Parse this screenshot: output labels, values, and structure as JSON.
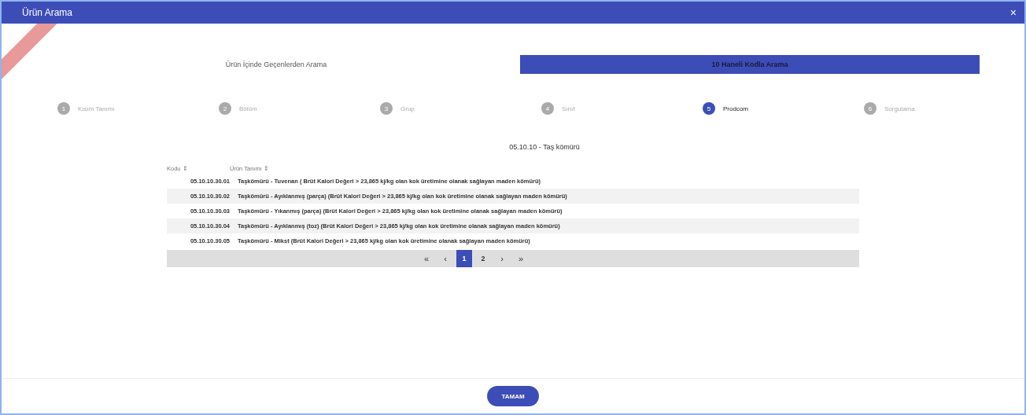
{
  "window": {
    "title": "Ürün Arama",
    "close": "×"
  },
  "tabs": [
    {
      "label": "Ürün İçinde Geçenlerden Arama",
      "selected": false
    },
    {
      "label": "10 Haneli Kodla Arama",
      "selected": true
    }
  ],
  "steps": [
    {
      "number": "1",
      "label": "Kısım Tanımı",
      "selected": false
    },
    {
      "number": "2",
      "label": "Bölüm",
      "selected": false
    },
    {
      "number": "3",
      "label": "Grup",
      "selected": false
    },
    {
      "number": "4",
      "label": "Sınıf",
      "selected": false
    },
    {
      "number": "5",
      "label": "Prodcom",
      "selected": true
    },
    {
      "number": "6",
      "label": "Sorgulama",
      "selected": false
    }
  ],
  "section_title": "05.10.10 - Taş kömürü",
  "table": {
    "columns": [
      {
        "label": "Kodu",
        "sort_icon": "⇕"
      },
      {
        "label": "Ürün Tanımı",
        "sort_icon": "⇕"
      }
    ],
    "rows": [
      {
        "code": "05.10.10.30.01",
        "description": "Taşkömürü - Tuvenan ( Brüt Kalori Değeri > 23,865 kj/kg olan kok üretimine olanak sağlayan maden kömürü)"
      },
      {
        "code": "05.10.10.30.02",
        "description": "Taşkömürü - Ayıklanmış (parça) (Brüt Kalori Değeri > 23,865 kj/kg olan kok üretimine olanak sağlayan maden kömürü)"
      },
      {
        "code": "05.10.10.30.03",
        "description": "Taşkömürü - Yıkanmış (parça) (Brüt Kalori Değeri > 23,865 kj/kg olan kok üretimine olanak sağlayan maden kömürü)"
      },
      {
        "code": "05.10.10.30.04",
        "description": "Taşkömürü - Ayıklanmış (toz) (Brüt Kalori Değeri > 23,865 kj/kg olan kok üretimine olanak sağlayan maden kömürü)"
      },
      {
        "code": "05.10.10.30.05",
        "description": "Taşkömürü - Mikst (Brüt Kalori Değeri > 23,865 kj/kg olan kok üretimine olanak sağlayan maden kömürü)"
      }
    ]
  },
  "pagination": [
    {
      "kind": "first",
      "label": "«",
      "selected": false
    },
    {
      "kind": "prev",
      "label": "‹",
      "selected": false
    },
    {
      "kind": "page",
      "label": "1",
      "selected": true
    },
    {
      "kind": "page",
      "label": "2",
      "selected": false
    },
    {
      "kind": "next",
      "label": "›",
      "selected": false
    },
    {
      "kind": "last",
      "label": "»",
      "selected": false
    }
  ],
  "ok_button": "TAMAM"
}
